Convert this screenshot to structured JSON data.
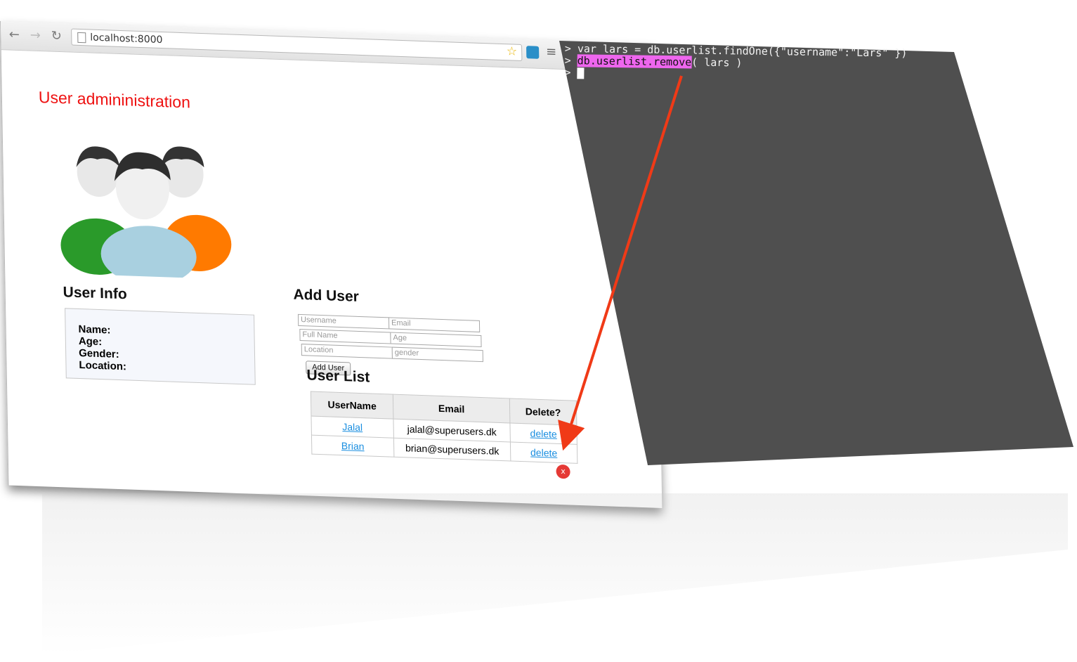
{
  "browser": {
    "url": "localhost:8000",
    "nav": {
      "back": "←",
      "forward": "→",
      "reload": "↻"
    }
  },
  "page": {
    "title": "User admininistration",
    "user_info": {
      "heading": "User Info",
      "labels": [
        "Name:",
        "Age:",
        "Gender:",
        "Location:"
      ]
    },
    "add_user": {
      "heading": "Add User",
      "placeholders": {
        "username": "Username",
        "email": "Email",
        "fullname": "Full Name",
        "age": "Age",
        "location": "Location",
        "gender": "gender"
      },
      "button_label": "Add User"
    },
    "user_list": {
      "heading": "User List",
      "columns": [
        "UserName",
        "Email",
        "Delete?"
      ],
      "rows": [
        {
          "username": "Jalal",
          "email": "jalal@superusers.dk",
          "action": "delete"
        },
        {
          "username": "Brian",
          "email": "brian@superusers.dk",
          "action": "delete"
        }
      ]
    },
    "badge": "x"
  },
  "terminal": {
    "line1": "> var lars = db.userlist.findOne({\"username\":\"Lars\" })",
    "line2_prompt": "> ",
    "line2_highlight": "db.userlist.remove",
    "line2_rest": "( lars )",
    "line3_prompt": "> "
  },
  "colors": {
    "title": "#ee1111",
    "link": "#1a8ee0",
    "terminal_bg": "#4f4f4f",
    "highlight": "#ee66ee",
    "arrow": "#f03a17"
  },
  "icons": [
    "back-arrow-icon",
    "forward-arrow-icon",
    "reload-icon",
    "page-icon",
    "star-icon",
    "extension-icon",
    "menu-icon",
    "users-group-icon"
  ]
}
